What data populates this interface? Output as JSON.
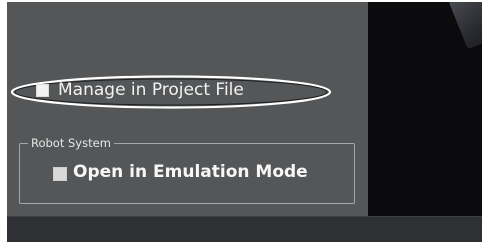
{
  "settings": {
    "manage_in_project_file": {
      "label": "Manage in Project File",
      "checked": false
    },
    "robot_system": {
      "group_label": "Robot System",
      "open_in_emulation_mode": {
        "label": "Open in Emulation Mode",
        "checked": false
      }
    }
  },
  "colors": {
    "panel_background": "#545658",
    "viewport_background": "#0b0b0d",
    "bottom_bar": "#2f3033",
    "text": "#f2f2f2",
    "highlight_ellipse": "#ffffff"
  }
}
